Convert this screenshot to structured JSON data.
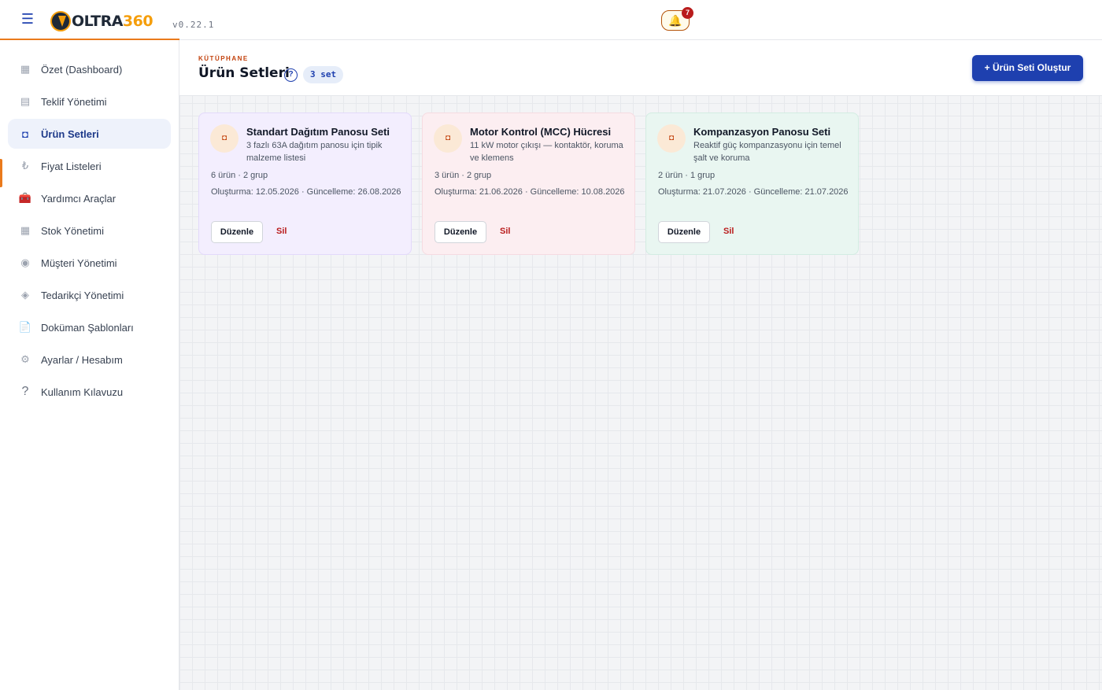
{
  "header": {
    "menu_icon": "hamburger-icon",
    "logo_text_main": "OLTRA",
    "logo_text_accent": "360",
    "version": "v0.22.1",
    "notification_icon": "bell-icon",
    "notification_count": "7"
  },
  "sidebar": {
    "items": [
      {
        "label": "Özet (Dashboard)",
        "icon": "dashboard-icon",
        "glyph": "▦"
      },
      {
        "label": "Teklif Yönetimi",
        "icon": "document-list-icon",
        "glyph": "▤"
      },
      {
        "label": "Ürün Setleri",
        "icon": "package-icon",
        "glyph": "◘",
        "active": true
      },
      {
        "label": "Fiyat Listeleri",
        "icon": "lira-icon",
        "glyph": "₺"
      },
      {
        "label": "Yardımcı Araçlar",
        "icon": "toolbox-icon",
        "glyph": "🧰"
      },
      {
        "label": "Stok Yönetimi",
        "icon": "inventory-icon",
        "glyph": "▦"
      },
      {
        "label": "Müşteri Yönetimi",
        "icon": "customer-icon",
        "glyph": "◉"
      },
      {
        "label": "Tedarikçi Yönetimi",
        "icon": "supplier-icon",
        "glyph": "◈"
      },
      {
        "label": "Doküman Şablonları",
        "icon": "file-icon",
        "glyph": "📄"
      },
      {
        "label": "Ayarlar / Hesabım",
        "icon": "gear-icon",
        "glyph": "⚙"
      },
      {
        "label": "Kullanım Kılavuzu",
        "icon": "question-icon",
        "glyph": "?"
      }
    ]
  },
  "page": {
    "eyebrow": "KÜTÜPHANE",
    "title": "Ürün Setleri",
    "help_glyph": "?",
    "count_badge": "3 set",
    "create_button": "+ Ürün Seti Oluştur"
  },
  "cards": [
    {
      "title": "Standart Dağıtım Panosu Seti",
      "description": "3 fazlı 63A dağıtım panosu için tipik malzeme listesi",
      "meta": "6 ürün · 2 grup",
      "dates": "Oluşturma: 12.05.2026 · Güncelleme: 26.08.2026",
      "edit_label": "Düzenle",
      "delete_label": "Sil",
      "icon": "package-icon",
      "color": "#f3eefe"
    },
    {
      "title": "Motor Kontrol (MCC) Hücresi",
      "description": "11 kW motor çıkışı — kontaktör, koruma ve klemens",
      "meta": "3 ürün · 2 grup",
      "dates": "Oluşturma: 21.06.2026 · Güncelleme: 10.08.2026",
      "edit_label": "Düzenle",
      "delete_label": "Sil",
      "icon": "package-icon",
      "color": "#fceef1"
    },
    {
      "title": "Kompanzasyon Panosu Seti",
      "description": "Reaktif güç kompanzasyonu için temel şalt ve koruma",
      "meta": "2 ürün · 1 grup",
      "dates": "Oluşturma: 21.07.2026 · Güncelleme: 21.07.2026",
      "edit_label": "Düzenle",
      "delete_label": "Sil",
      "icon": "package-icon",
      "color": "#e9f6f1"
    }
  ],
  "colors": {
    "primary": "#1e40af",
    "accent": "#ea7a1c",
    "danger": "#b91c1c"
  }
}
